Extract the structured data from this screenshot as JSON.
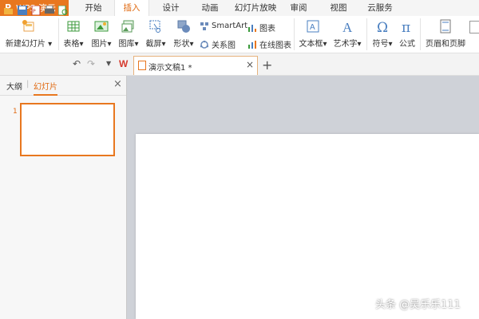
{
  "app": {
    "name": "WPS 演示"
  },
  "menu": {
    "tabs": [
      "开始",
      "插入",
      "设计",
      "动画",
      "幻灯片放映",
      "审阅",
      "视图",
      "云服务"
    ],
    "active": "插入"
  },
  "ribbon": {
    "new_slide": "新建幻灯片",
    "table": "表格",
    "picture": "图片",
    "gallery": "图库",
    "screenshot": "截屏",
    "shape": "形状",
    "smartart": "SmartArt",
    "relation": "关系图",
    "chart": "图表",
    "online_chart": "在线图表",
    "textbox": "文本框",
    "wordart": "艺术字",
    "symbol": "符号",
    "formula": "公式",
    "header_footer": "页眉和页脚"
  },
  "document": {
    "tab_title": "演示文稿1 *"
  },
  "pane": {
    "tab_outline": "大纲",
    "tab_slides": "幻灯片",
    "slide_number": "1"
  },
  "watermark": "头条 @吴乐乐111",
  "colors": {
    "accent": "#e8771f"
  }
}
